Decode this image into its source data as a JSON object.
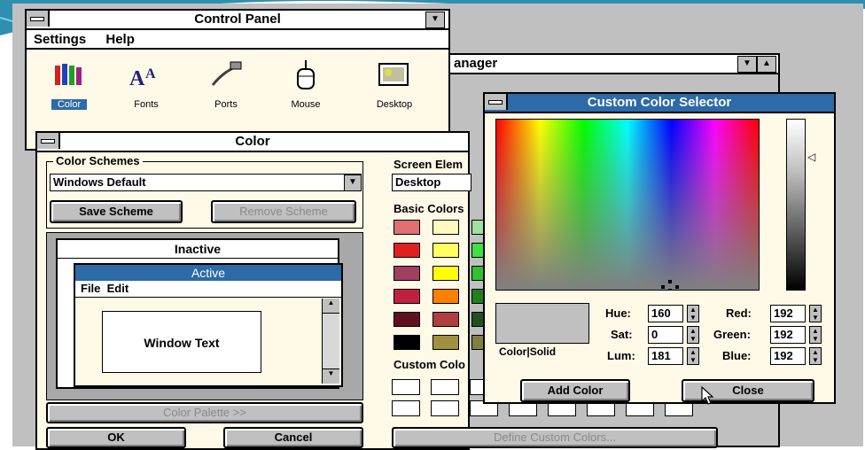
{
  "colors": {
    "accent": "#2c6aa8",
    "desktop": "#c0c0c0",
    "background": "#ffffff"
  },
  "control_panel": {
    "title": "Control Panel",
    "menu": [
      "Settings",
      "Help"
    ],
    "icons": [
      {
        "name": "color-icon",
        "label": "Color"
      },
      {
        "name": "fonts-icon",
        "label": "Fonts"
      },
      {
        "name": "ports-icon",
        "label": "Ports"
      },
      {
        "name": "mouse-icon",
        "label": "Mouse"
      },
      {
        "name": "desktop-icon",
        "label": "Desktop"
      }
    ]
  },
  "manager_window": {
    "title": "anager"
  },
  "color_dialog": {
    "title": "Color",
    "schemes_label": "Color Schemes",
    "scheme_value": "Windows Default",
    "save_scheme": "Save Scheme",
    "remove_scheme": "Remove Scheme",
    "preview": {
      "inactive_title": "Inactive",
      "active_title": "Active",
      "menu": "File  Edit",
      "window_text": "Window Text"
    },
    "color_palette": "Color Palette >>",
    "ok": "OK",
    "cancel": "Cancel",
    "screen_element_label": "Screen Elem",
    "screen_element_value": "Desktop",
    "basic_colors_label": "Basic Colors",
    "basic_colors": [
      [
        "#e07070",
        "#fff8c0",
        "#a0e0a0"
      ],
      [
        "#e02020",
        "#ffff60",
        "#40e040"
      ],
      [
        "#a04060",
        "#ffff00",
        "#30c030"
      ],
      [
        "#c02040",
        "#ff8000",
        "#208020"
      ],
      [
        "#601020",
        "#b04040",
        "#205020"
      ],
      [
        "#000000",
        "#a09040",
        "#808040"
      ]
    ],
    "custom_colors_label": "Custom Colo",
    "define_custom": "Define Custom Colors..."
  },
  "custom_color_selector": {
    "title": "Custom Color Selector",
    "color_solid_label": "Color|Solid",
    "preview_color": "#c0c0c0",
    "hue_label": "Hue:",
    "hue": "160",
    "sat_label": "Sat:",
    "sat": "0",
    "lum_label": "Lum:",
    "lum": "181",
    "red_label": "Red:",
    "red": "192",
    "green_label": "Green:",
    "green": "192",
    "blue_label": "Blue:",
    "blue": "192",
    "add_color": "Add Color",
    "close": "Close"
  }
}
